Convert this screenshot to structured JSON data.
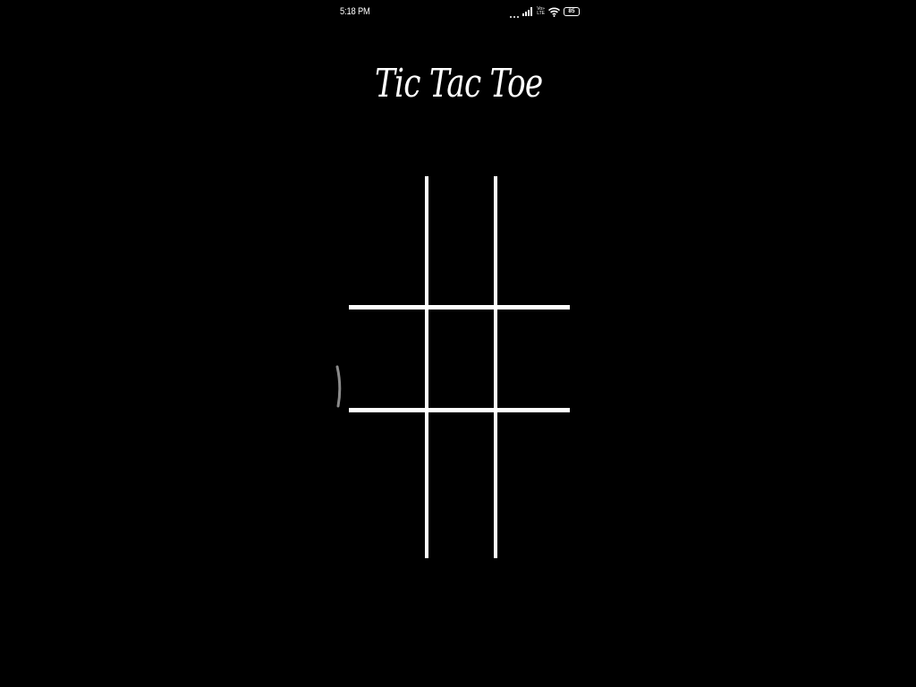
{
  "status_bar": {
    "time": "5:18 PM",
    "volte_top": "Vo»",
    "volte_bottom": "LTE",
    "battery": "85",
    "icons": [
      "dots-icon",
      "signal-icon",
      "volte-icon",
      "wifi-icon",
      "battery-icon"
    ]
  },
  "app": {
    "title": "Tic Tac Toe"
  },
  "board": {
    "cells": [
      [
        "",
        "",
        ""
      ],
      [
        "",
        "",
        ""
      ],
      [
        "",
        "",
        ""
      ]
    ]
  },
  "colors": {
    "background": "#000000",
    "foreground": "#ffffff",
    "scroll_indicator": "#8a8a8a"
  }
}
